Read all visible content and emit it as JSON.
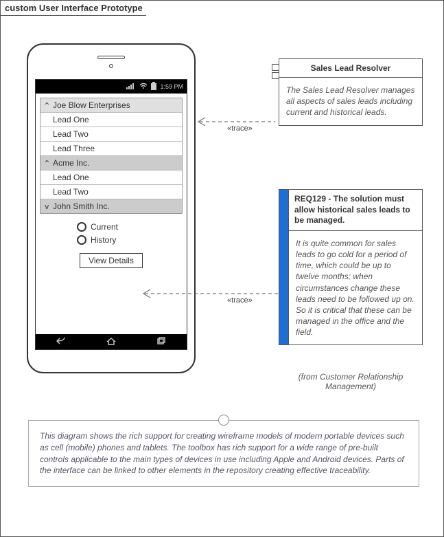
{
  "frame": {
    "title": "custom User Interface Prototype"
  },
  "phone": {
    "status": {
      "time": "1:59 PM"
    },
    "list": {
      "groups": [
        {
          "label": "Joe Blow Enterprises",
          "expanded": true,
          "selected": true,
          "items": [
            "Lead One",
            "Lead Two",
            "Lead Three"
          ]
        },
        {
          "label": "Acme Inc.",
          "expanded": true,
          "selected": false,
          "items": [
            "Lead One",
            "Lead Two"
          ]
        },
        {
          "label": "John Smith Inc.",
          "expanded": false,
          "selected": false,
          "items": []
        }
      ]
    },
    "radios": {
      "options": [
        "Current",
        "History"
      ]
    },
    "button": {
      "label": "View Details"
    }
  },
  "traces": {
    "label1": "«trace»",
    "label2": "«trace»"
  },
  "component": {
    "title": "Sales Lead Resolver",
    "body": "The Sales Lead Resolver manages all aspects of sales leads including current and historical leads."
  },
  "requirement": {
    "title": "REQ129 - The solution must allow historical sales leads to be managed.",
    "body": "It is quite common for sales leads to go cold for a period of time, which could be up to twelve months; when circumstances change these leads need to be followed up on. So it is critical that these can be managed in the office and the field.",
    "source": "(from Customer Relationship Management)"
  },
  "note": {
    "text": "This diagram shows the rich support for creating wireframe models of modern portable devices such as cell (mobile) phones and tablets. The toolbox has rich support for a wide range of pre-built controls applicable to the main types of devices in use including Apple and Android devices. Parts of the interface can be linked to other elements in the repository creating effective traceability."
  }
}
